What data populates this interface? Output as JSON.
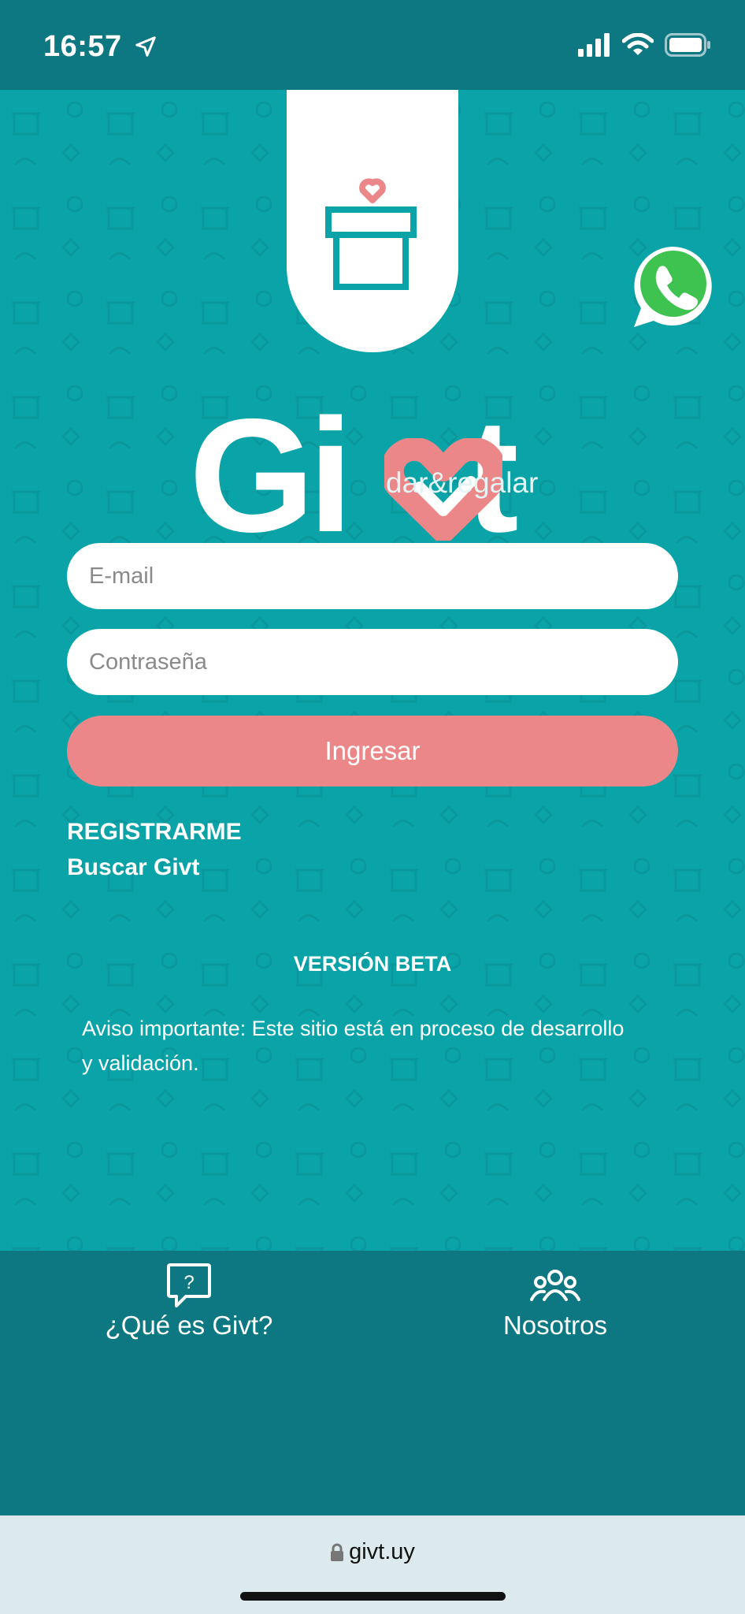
{
  "status": {
    "time": "16:57"
  },
  "brand": {
    "name_part1": "Gi",
    "name_part2": "t",
    "tagline": "dar&regalar"
  },
  "form": {
    "email_placeholder": "E-mail",
    "password_placeholder": "Contraseña",
    "login_label": "Ingresar"
  },
  "links": {
    "register": "REGISTRARME",
    "search": "Buscar Givt"
  },
  "beta": {
    "title": "VERSIÓN BETA",
    "notice": "Aviso importante: Este sitio está en proceso de desarrollo y validación."
  },
  "nav": {
    "what": {
      "label": "¿Qué es Givt?",
      "icon": "question-bubble-icon"
    },
    "about": {
      "label": "Nosotros",
      "icon": "group-icon"
    }
  },
  "browser": {
    "url": "givt.uy"
  },
  "colors": {
    "teal": "#0aa4a8",
    "dark_teal": "#0d7782",
    "coral": "#ec8789"
  }
}
